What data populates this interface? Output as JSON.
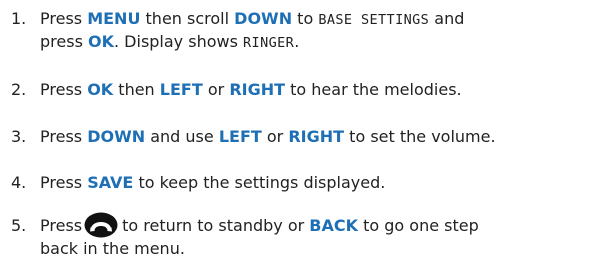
{
  "colors": {
    "keyword": "#1f6fb5",
    "text": "#222222"
  },
  "steps": [
    {
      "number": "1.",
      "press": "Press",
      "key1": "MENU",
      "then_scroll": "then scroll",
      "key2": "DOWN",
      "to": "to",
      "display1": "BASE SETTINGS",
      "and": "and",
      "press2": "press",
      "key3": "OK",
      "display_shows": ". Display shows",
      "display2": "RINGER",
      "end": "."
    },
    {
      "number": "2.",
      "press": "Press",
      "key1": "OK",
      "then": "then",
      "key2": "LEFT",
      "or": "or",
      "key3": "RIGHT",
      "rest": "to hear the melodies."
    },
    {
      "number": "3.",
      "press": "Press",
      "key1": "DOWN",
      "and_use": "and use",
      "key2": "LEFT",
      "or": "or",
      "key3": "RIGHT",
      "rest": "to set the volume."
    },
    {
      "number": "4.",
      "press": "Press",
      "key1": "SAVE",
      "rest": "to keep the settings displayed."
    },
    {
      "number": "5.",
      "press": "Press",
      "icon": "end-call-handset-icon",
      "to_return": "to return to standby or",
      "key1": "BACK",
      "rest_line1": "to go one step",
      "rest_line2": "back in the menu."
    }
  ]
}
